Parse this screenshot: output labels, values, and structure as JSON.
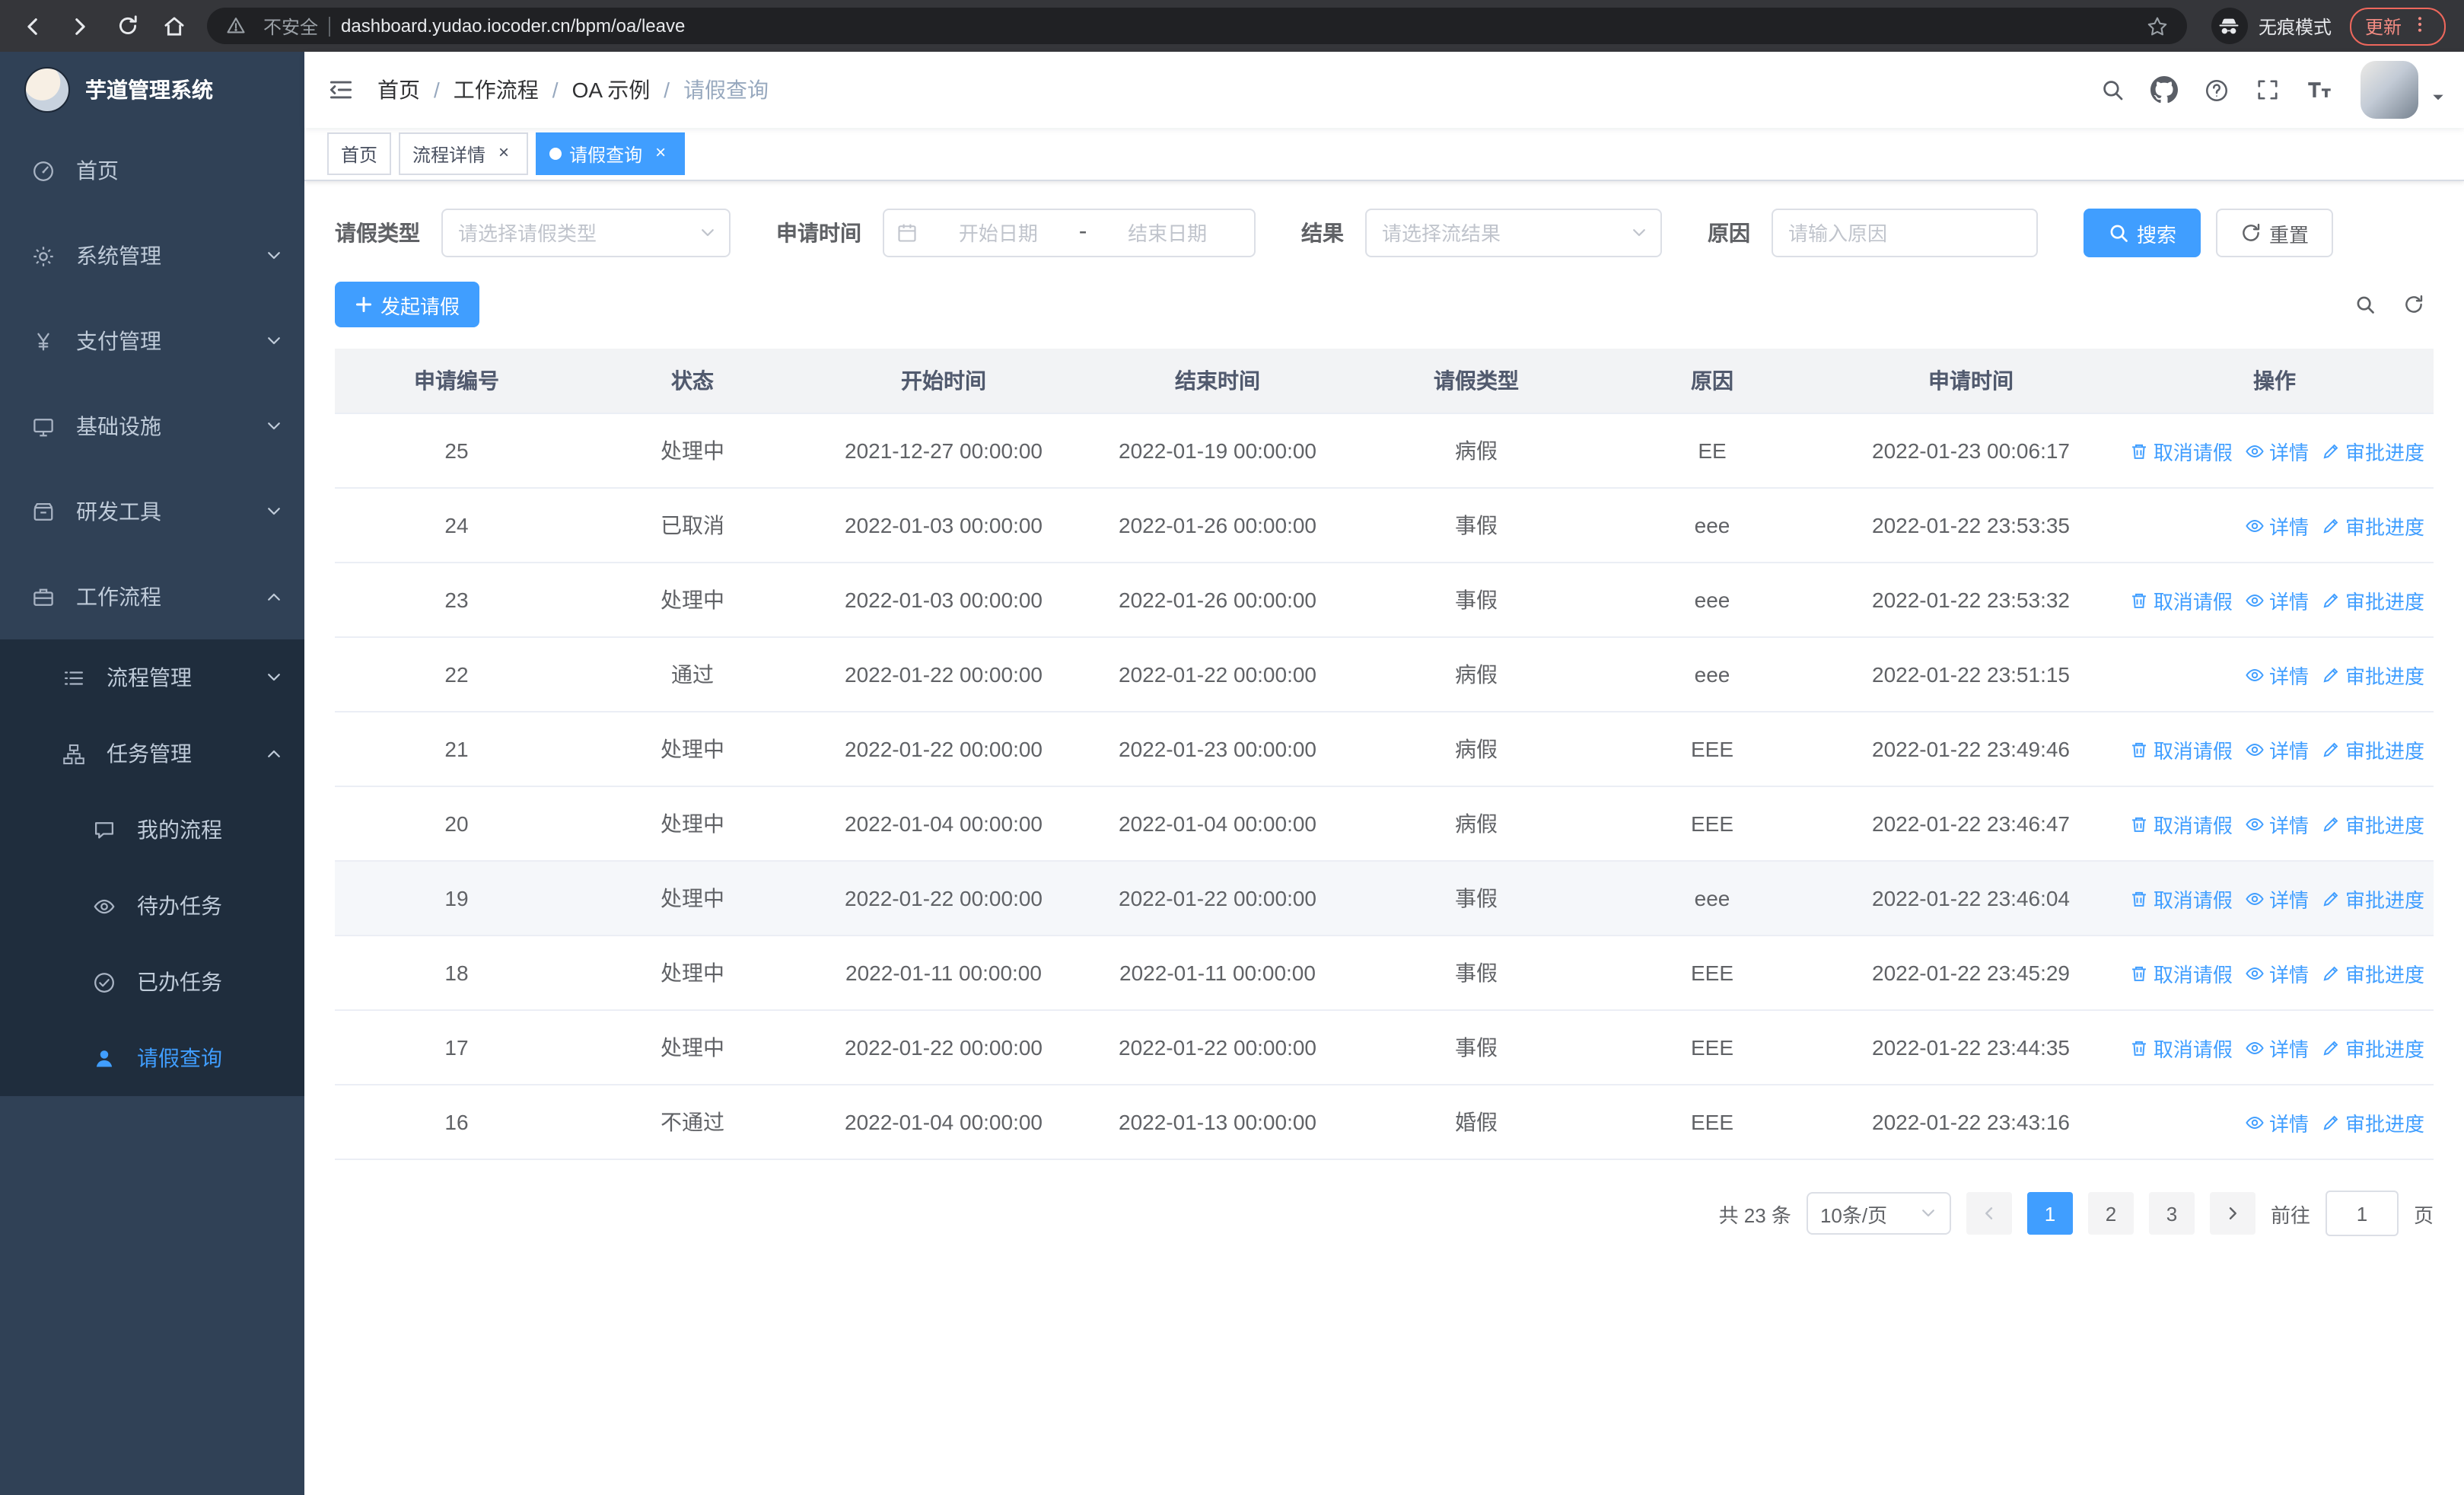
{
  "browser": {
    "security_label": "不安全",
    "url": "dashboard.yudao.iocoder.cn/bpm/oa/leave",
    "incognito_label": "无痕模式",
    "update_label": "更新"
  },
  "sidebar": {
    "logo_title": "芋道管理系统",
    "items": [
      {
        "label": "首页",
        "icon": "dashboard",
        "level": 1,
        "expandable": false,
        "expanded": false,
        "active": false
      },
      {
        "label": "系统管理",
        "icon": "gear",
        "level": 1,
        "expandable": true,
        "expanded": false,
        "active": false
      },
      {
        "label": "支付管理",
        "icon": "yen",
        "level": 1,
        "expandable": true,
        "expanded": false,
        "active": false
      },
      {
        "label": "基础设施",
        "icon": "infra",
        "level": 1,
        "expandable": true,
        "expanded": false,
        "active": false
      },
      {
        "label": "研发工具",
        "icon": "tools",
        "level": 1,
        "expandable": true,
        "expanded": false,
        "active": false
      },
      {
        "label": "工作流程",
        "icon": "workflow",
        "level": 1,
        "expandable": true,
        "expanded": true,
        "active": false
      },
      {
        "label": "流程管理",
        "icon": "process",
        "level": 2,
        "expandable": true,
        "expanded": false,
        "active": false
      },
      {
        "label": "任务管理",
        "icon": "task",
        "level": 2,
        "expandable": true,
        "expanded": true,
        "active": false
      },
      {
        "label": "我的流程",
        "icon": "chat",
        "level": 3,
        "expandable": false,
        "expanded": false,
        "active": false
      },
      {
        "label": "待办任务",
        "icon": "eye",
        "level": 3,
        "expandable": false,
        "expanded": false,
        "active": false
      },
      {
        "label": "已办任务",
        "icon": "done",
        "level": 3,
        "expandable": false,
        "expanded": false,
        "active": false
      },
      {
        "label": "请假查询",
        "icon": "user",
        "level": 3,
        "expandable": false,
        "expanded": false,
        "active": true
      }
    ]
  },
  "header": {
    "breadcrumb_separator": "/",
    "breadcrumb": [
      {
        "label": "首页",
        "sep": true,
        "current": false
      },
      {
        "label": "工作流程",
        "sep": true,
        "current": false
      },
      {
        "label": "OA 示例",
        "sep": true,
        "current": false
      },
      {
        "label": "请假查询",
        "sep": false,
        "current": true
      }
    ]
  },
  "tabs": {
    "items": [
      {
        "label": "首页",
        "dot": false,
        "closable": false,
        "active": false
      },
      {
        "label": "流程详情",
        "dot": false,
        "closable": true,
        "active": false
      },
      {
        "label": "请假查询",
        "dot": true,
        "closable": true,
        "active": true
      }
    ]
  },
  "filters": {
    "leave_type": {
      "label": "请假类型",
      "placeholder": "请选择请假类型"
    },
    "apply_time": {
      "label": "申请时间",
      "start_placeholder": "开始日期",
      "separator": "-",
      "end_placeholder": "结束日期"
    },
    "result": {
      "label": "结果",
      "placeholder": "请选择流结果"
    },
    "reason": {
      "label": "原因",
      "placeholder": "请输入原因"
    },
    "search_label": "搜索",
    "reset_label": "重置"
  },
  "toolbar": {
    "create_label": "发起请假"
  },
  "colors": {
    "accent": "#409eff",
    "sidebar_bg": "#304156",
    "submenu_bg": "#1f2d3d"
  },
  "table": {
    "columns": [
      "申请编号",
      "状态",
      "开始时间",
      "结束时间",
      "请假类型",
      "原因",
      "申请时间",
      "操作"
    ],
    "action_labels": {
      "cancel": "取消请假",
      "detail": "详情",
      "progress": "审批进度"
    },
    "rows": [
      {
        "id": "25",
        "status": "处理中",
        "start": "2021-12-27 00:00:00",
        "end": "2022-01-19 00:00:00",
        "type": "病假",
        "reason": "EE",
        "applied": "2022-01-23 00:06:17",
        "can_cancel": true,
        "highlighted": false
      },
      {
        "id": "24",
        "status": "已取消",
        "start": "2022-01-03 00:00:00",
        "end": "2022-01-26 00:00:00",
        "type": "事假",
        "reason": "eee",
        "applied": "2022-01-22 23:53:35",
        "can_cancel": false,
        "highlighted": false
      },
      {
        "id": "23",
        "status": "处理中",
        "start": "2022-01-03 00:00:00",
        "end": "2022-01-26 00:00:00",
        "type": "事假",
        "reason": "eee",
        "applied": "2022-01-22 23:53:32",
        "can_cancel": true,
        "highlighted": false
      },
      {
        "id": "22",
        "status": "通过",
        "start": "2022-01-22 00:00:00",
        "end": "2022-01-22 00:00:00",
        "type": "病假",
        "reason": "eee",
        "applied": "2022-01-22 23:51:15",
        "can_cancel": false,
        "highlighted": false
      },
      {
        "id": "21",
        "status": "处理中",
        "start": "2022-01-22 00:00:00",
        "end": "2022-01-23 00:00:00",
        "type": "病假",
        "reason": "EEE",
        "applied": "2022-01-22 23:49:46",
        "can_cancel": true,
        "highlighted": false
      },
      {
        "id": "20",
        "status": "处理中",
        "start": "2022-01-04 00:00:00",
        "end": "2022-01-04 00:00:00",
        "type": "病假",
        "reason": "EEE",
        "applied": "2022-01-22 23:46:47",
        "can_cancel": true,
        "highlighted": false
      },
      {
        "id": "19",
        "status": "处理中",
        "start": "2022-01-22 00:00:00",
        "end": "2022-01-22 00:00:00",
        "type": "事假",
        "reason": "eee",
        "applied": "2022-01-22 23:46:04",
        "can_cancel": true,
        "highlighted": true
      },
      {
        "id": "18",
        "status": "处理中",
        "start": "2022-01-11 00:00:00",
        "end": "2022-01-11 00:00:00",
        "type": "事假",
        "reason": "EEE",
        "applied": "2022-01-22 23:45:29",
        "can_cancel": true,
        "highlighted": false
      },
      {
        "id": "17",
        "status": "处理中",
        "start": "2022-01-22 00:00:00",
        "end": "2022-01-22 00:00:00",
        "type": "事假",
        "reason": "EEE",
        "applied": "2022-01-22 23:44:35",
        "can_cancel": true,
        "highlighted": false
      },
      {
        "id": "16",
        "status": "不通过",
        "start": "2022-01-04 00:00:00",
        "end": "2022-01-13 00:00:00",
        "type": "婚假",
        "reason": "EEE",
        "applied": "2022-01-22 23:43:16",
        "can_cancel": false,
        "highlighted": false
      }
    ]
  },
  "pagination": {
    "total_label": "共 23 条",
    "page_size_label": "10条/页",
    "pages": [
      {
        "n": "1",
        "active": true
      },
      {
        "n": "2",
        "active": false
      },
      {
        "n": "3",
        "active": false
      }
    ],
    "goto_label": "前往",
    "goto_value": "1",
    "goto_suffix": "页"
  }
}
